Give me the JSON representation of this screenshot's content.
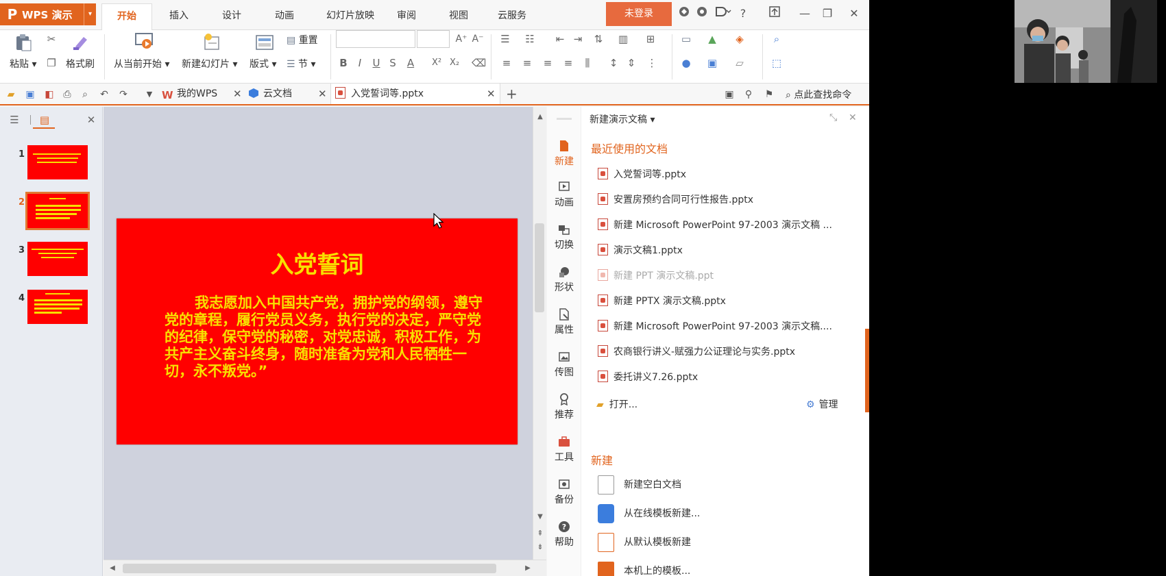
{
  "app": {
    "name": "WPS 演示",
    "logo": "P",
    "menu_caret": "▾"
  },
  "ribbon_tabs": [
    {
      "label": "开始",
      "active": true
    },
    {
      "label": "插入"
    },
    {
      "label": "设计"
    },
    {
      "label": "动画"
    },
    {
      "label": "幻灯片放映"
    },
    {
      "label": "审阅"
    },
    {
      "label": "视图"
    },
    {
      "label": "云服务"
    }
  ],
  "login_label": "未登录",
  "window_controls": {
    "help": "?",
    "minimize": "—",
    "restore": "❐",
    "close": "✕"
  },
  "ribbon": {
    "paste": "粘贴",
    "format_painter": "格式刷",
    "from_current": "从当前开始",
    "new_slide": "新建幻灯片",
    "layout": "版式",
    "reset": "重置",
    "section": "节",
    "bold": "B",
    "italic": "I",
    "underline": "U",
    "strike": "S",
    "font_color": "A",
    "superscript": "X²",
    "subscript": "X₂",
    "grow": "A⁺",
    "shrink": "A⁻"
  },
  "doc_tabs": {
    "my_wps": "我的WPS",
    "cloud_docs": "云文档",
    "current": "入党誓词等.pptx",
    "close": "✕",
    "add": "+"
  },
  "search_command": "点此查找命令",
  "thumbnails": [
    {
      "num": "1"
    },
    {
      "num": "2"
    },
    {
      "num": "3"
    },
    {
      "num": "4"
    }
  ],
  "slide": {
    "title": "入党誓词",
    "body": "我志愿加入中国共产党，拥护党的纲领，遵守党的章程，履行党员义务，执行党的决定，严守党的纪律，保守党的秘密，对党忠诚，积极工作，为共产主义奋斗终身，随时准备为党和人民牺牲一切，永不叛党。”"
  },
  "task_pane": {
    "header": "新建演示文稿",
    "recent_title": "最近使用的文档",
    "recent_files": [
      "入党誓词等.pptx",
      "安置房预约合同可行性报告.pptx",
      "新建 Microsoft PowerPoint 97-2003 演示文稿 ...",
      "演示文稿1.pptx",
      "新建 PPT 演示文稿.ppt",
      "新建 PPTX 演示文稿.pptx",
      "新建 Microsoft PowerPoint 97-2003 演示文稿....",
      "农商银行讲义-赋强力公证理论与实务.pptx",
      "委托讲义7.26.pptx"
    ],
    "open_label": "打开...",
    "manage_label": "管理",
    "new_title": "新建",
    "new_items": [
      "新建空白文档",
      "从在线模板新建...",
      "从默认模板新建",
      "本机上的模板..."
    ],
    "side_tools": [
      "新建",
      "动画",
      "切换",
      "形状",
      "属性",
      "传图",
      "推荐",
      "工具",
      "备份",
      "帮助"
    ]
  },
  "colors": {
    "accent": "#e1641e",
    "slide_bg": "#ff0000",
    "slide_text": "#f8e000"
  }
}
